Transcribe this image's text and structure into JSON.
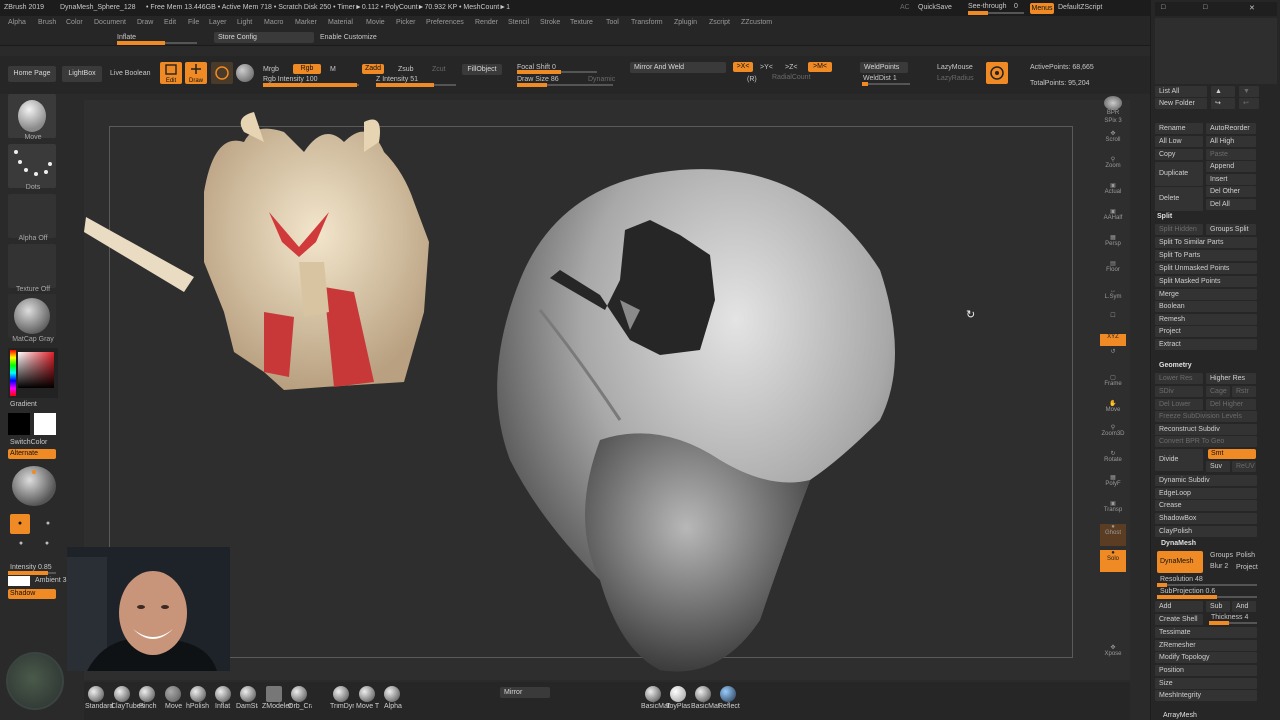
{
  "titlebar": {
    "app": "ZBrush 2019",
    "doc": "DynaMesh_Sphere_128",
    "stats": "• Free Mem 13.446GB • Active Mem 718 • Scratch Disk 250 • Timer►0.112 • PolyCount►70.932 KP • MeshCount►1",
    "ac": "AC",
    "quicksave": "QuickSave",
    "see_through": "See-through",
    "see_through_value": "0",
    "menus": "Menus",
    "default_zscript": "DefaultZScript"
  },
  "menubar": [
    "Alpha",
    "Brush",
    "Color",
    "Document",
    "Draw",
    "Edit",
    "File",
    "Layer",
    "Light",
    "Macro",
    "Marker",
    "Material",
    "Movie",
    "Picker",
    "Preferences",
    "Render",
    "Stencil",
    "Stroke",
    "Texture",
    "Tool",
    "Transform",
    "Zplugin",
    "Zscript",
    "ZZcustom"
  ],
  "subbar": {
    "inflate": "Inflate",
    "store_config": "Store Config",
    "enable_customize": "Enable Customize"
  },
  "toolbar": {
    "home_page": "Home Page",
    "lightbox": "LightBox",
    "live_boolean": "Live Boolean",
    "edit": "Edit",
    "draw": "Draw",
    "mrgb": "Mrgb",
    "rgb": "Rgb",
    "m": "M",
    "rgb_intensity": "Rgb Intensity 100",
    "zadd": "Zadd",
    "zsub": "Zsub",
    "zcut": "Zcut",
    "z_intensity": "Z Intensity 51",
    "fill_object": "FillObject",
    "focal_shift": "Focal Shift 0",
    "draw_size": "Draw Size 86",
    "dynamic": "Dynamic",
    "mirror_weld": "Mirror And Weld",
    "x_axis": ">X<",
    "y_axis": ">Y<",
    "z_axis": ">Z<",
    "m_axis": ">M<",
    "r": "(R)",
    "radial_count": "RadialCount",
    "weld_points": "WeldPoints",
    "weld_dist": "WeldDist 1",
    "lazy_mouse": "LazyMouse",
    "lazy_radius": "LazyRadius",
    "active_points": "ActivePoints: 68,665",
    "total_points": "TotalPoints: 95,204"
  },
  "left_tray": {
    "move": "Move",
    "dots": "Dots",
    "alpha_off": "Alpha Off",
    "texture_off": "Texture Off",
    "matcap": "MatCap Gray",
    "gradient": "Gradient",
    "switch_color": "SwitchColor",
    "alternate": "Alternate",
    "intensity": "Intensity 0.85",
    "ambient": "Ambient 3",
    "shadow": "Shadow"
  },
  "right_tools": [
    "BPR",
    "SPix 3",
    "Scroll",
    "Zoom",
    "Actual",
    "AAHalf",
    "Persp",
    "Floor",
    "L.Sym",
    "Lock",
    "XYZ",
    "",
    "",
    "Frame",
    "Move",
    "Zoom3D",
    "Rotate",
    "PolyF",
    "Transp",
    "Ghost",
    "Solo",
    "Xpose"
  ],
  "rpanel": {
    "list_all": "List All",
    "new_folder": "New Folder",
    "rename": "Rename",
    "auto_reorder": "AutoReorder",
    "all_low": "All Low",
    "all_high": "All High",
    "copy": "Copy",
    "paste": "Paste",
    "duplicate": "Duplicate",
    "append": "Append",
    "insert": "Insert",
    "delete": "Delete",
    "del_other": "Del Other",
    "del_all": "Del All",
    "split": "Split",
    "split_hidden": "Split Hidden",
    "groups_split": "Groups Split",
    "split_similar": "Split To Similar Parts",
    "split_parts": "Split To Parts",
    "split_unmasked": "Split Unmasked Points",
    "split_masked": "Split Masked Points",
    "merge": "Merge",
    "boolean": "Boolean",
    "remesh": "Remesh",
    "project": "Project",
    "extract": "Extract",
    "geometry": "Geometry",
    "lower_res": "Lower Res",
    "higher_res": "Higher Res",
    "sdiv": "SDiv",
    "cage": "Cage",
    "rstr": "Rstr",
    "del_lower": "Del Lower",
    "del_higher": "Del Higher",
    "freeze": "Freeze SubDivision Levels",
    "reconstruct": "Reconstruct Subdiv",
    "convert_bpr": "Convert BPR To Geo",
    "divide": "Divide",
    "smt": "Smt",
    "suv": "Suv",
    "reuv": "ReUV",
    "dynamic_subdiv": "Dynamic Subdiv",
    "edgeloop": "EdgeLoop",
    "crease": "Crease",
    "shadowbox": "ShadowBox",
    "claypolish": "ClayPolish",
    "dynamesh_head": "DynaMesh",
    "dynamesh": "DynaMesh",
    "groups": "Groups",
    "polish": "Polish",
    "blur": "Blur 2",
    "project2": "Project",
    "resolution": "Resolution 48",
    "subprojection": "SubProjection 0.6",
    "add": "Add",
    "sub": "Sub",
    "and": "And",
    "create_shell": "Create Shell",
    "thickness": "Thickness 4",
    "tessimate": "Tessimate",
    "zremesher": "ZRemesher",
    "modify_topology": "Modify Topology",
    "position": "Position",
    "size": "Size",
    "meshintegrity": "MeshIntegrity",
    "arraymesh": "ArrayMesh"
  },
  "bottom": {
    "brushes": [
      "Standard",
      "ClayTubes",
      "Pinch",
      "Move",
      "hPolish",
      "Inflat",
      "DamStandard",
      "ZModeler",
      "Orb_Cracks",
      "TrimDynamic",
      "Move T",
      "Alpha"
    ],
    "mirror": "Mirror",
    "materials": [
      "BasicMat",
      "ToyPlastic",
      "BasicMat",
      "Reflect"
    ]
  },
  "colors": {
    "accent": "#f08a24",
    "panel": "#262626",
    "canvas": "#2e2e2e"
  }
}
